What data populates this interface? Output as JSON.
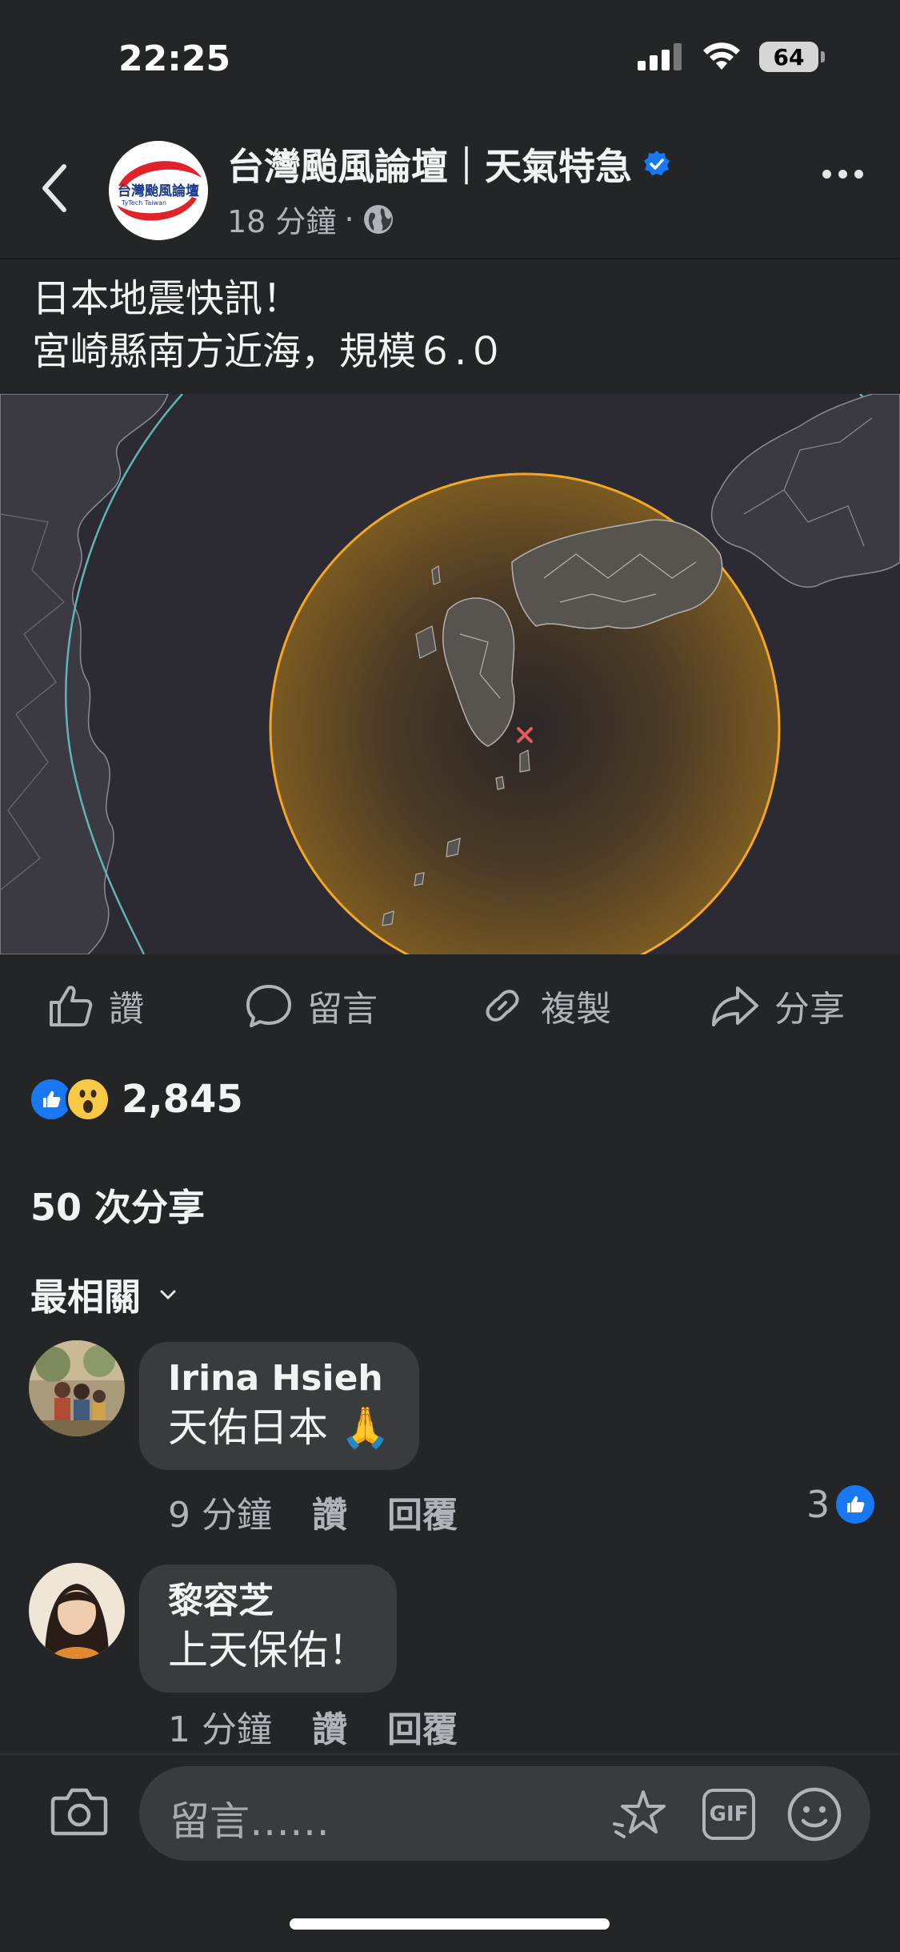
{
  "status_bar": {
    "time": "22:25",
    "battery": "64"
  },
  "header": {
    "page_name": "台灣颱風論壇｜天氣特急",
    "time_ago": "18 分鐘",
    "separator": "·",
    "avatar_logo_text": "台灣颱風論壇",
    "avatar_logo_sub": "TyTech Taiwan"
  },
  "post": {
    "line1": "日本地震快訊！",
    "line2": "宮崎縣南方近海，規模６.０"
  },
  "actions": {
    "like": "讚",
    "comment": "留言",
    "copy": "複製",
    "share": "分享"
  },
  "reactions": {
    "count": "2,845"
  },
  "shares": {
    "label": "50 次分享"
  },
  "sort": {
    "label": "最相關"
  },
  "comments": [
    {
      "name": "Irina Hsieh",
      "text": "天佑日本",
      "emoji": "🙏",
      "time": "9 分鐘",
      "like": "讚",
      "reply": "回覆",
      "likes": "3"
    },
    {
      "name": "黎容芝",
      "text": "上天保佑！",
      "time": "1 分鐘",
      "like": "讚",
      "reply": "回覆"
    }
  ],
  "composer": {
    "placeholder": "留言……",
    "gif": "GIF"
  },
  "colors": {
    "background": "#242526",
    "bubble": "#3a3b3c",
    "accent_blue": "#1877f2",
    "circle_orange": "#f5a623"
  }
}
